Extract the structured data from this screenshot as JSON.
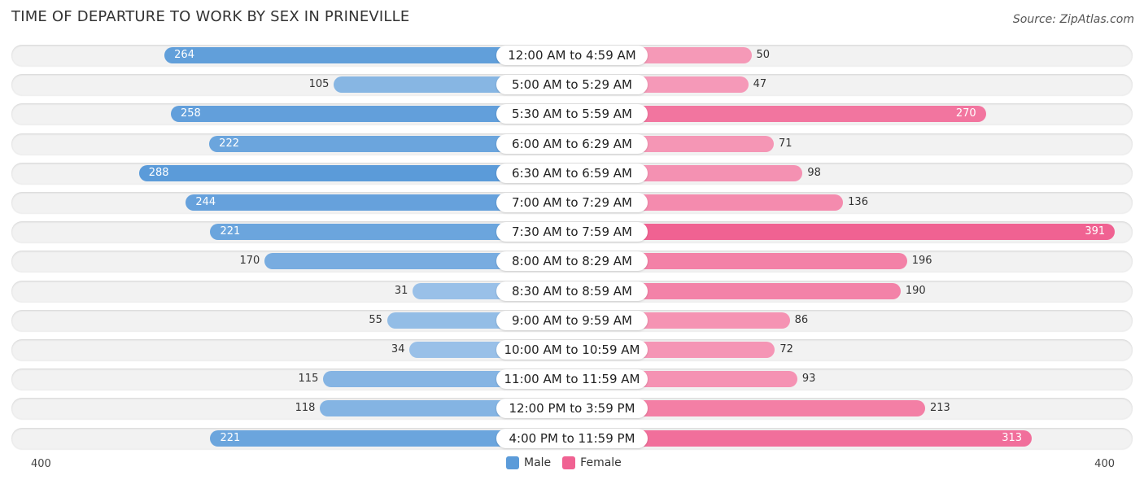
{
  "chart_data": {
    "type": "bar",
    "orientation": "horizontal-diverging",
    "title": "TIME OF DEPARTURE TO WORK BY SEX IN PRINEVILLE",
    "source": "Source: ZipAtlas.com",
    "categories": [
      "12:00 AM to 4:59 AM",
      "5:00 AM to 5:29 AM",
      "5:30 AM to 5:59 AM",
      "6:00 AM to 6:29 AM",
      "6:30 AM to 6:59 AM",
      "7:00 AM to 7:29 AM",
      "7:30 AM to 7:59 AM",
      "8:00 AM to 8:29 AM",
      "8:30 AM to 8:59 AM",
      "9:00 AM to 9:59 AM",
      "10:00 AM to 10:59 AM",
      "11:00 AM to 11:59 AM",
      "12:00 PM to 3:59 PM",
      "4:00 PM to 11:59 PM"
    ],
    "series": [
      {
        "name": "Male",
        "color": "#5b9bd9",
        "values": [
          264,
          105,
          258,
          222,
          288,
          244,
          221,
          170,
          31,
          55,
          34,
          115,
          118,
          221
        ]
      },
      {
        "name": "Female",
        "color": "#f06292",
        "values": [
          50,
          47,
          270,
          71,
          98,
          136,
          391,
          196,
          190,
          86,
          72,
          93,
          213,
          313
        ]
      }
    ],
    "axis": {
      "left_label": "400",
      "right_label": "400",
      "max": 400
    },
    "legend": {
      "position": "bottom-center",
      "items": [
        "Male",
        "Female"
      ]
    }
  }
}
